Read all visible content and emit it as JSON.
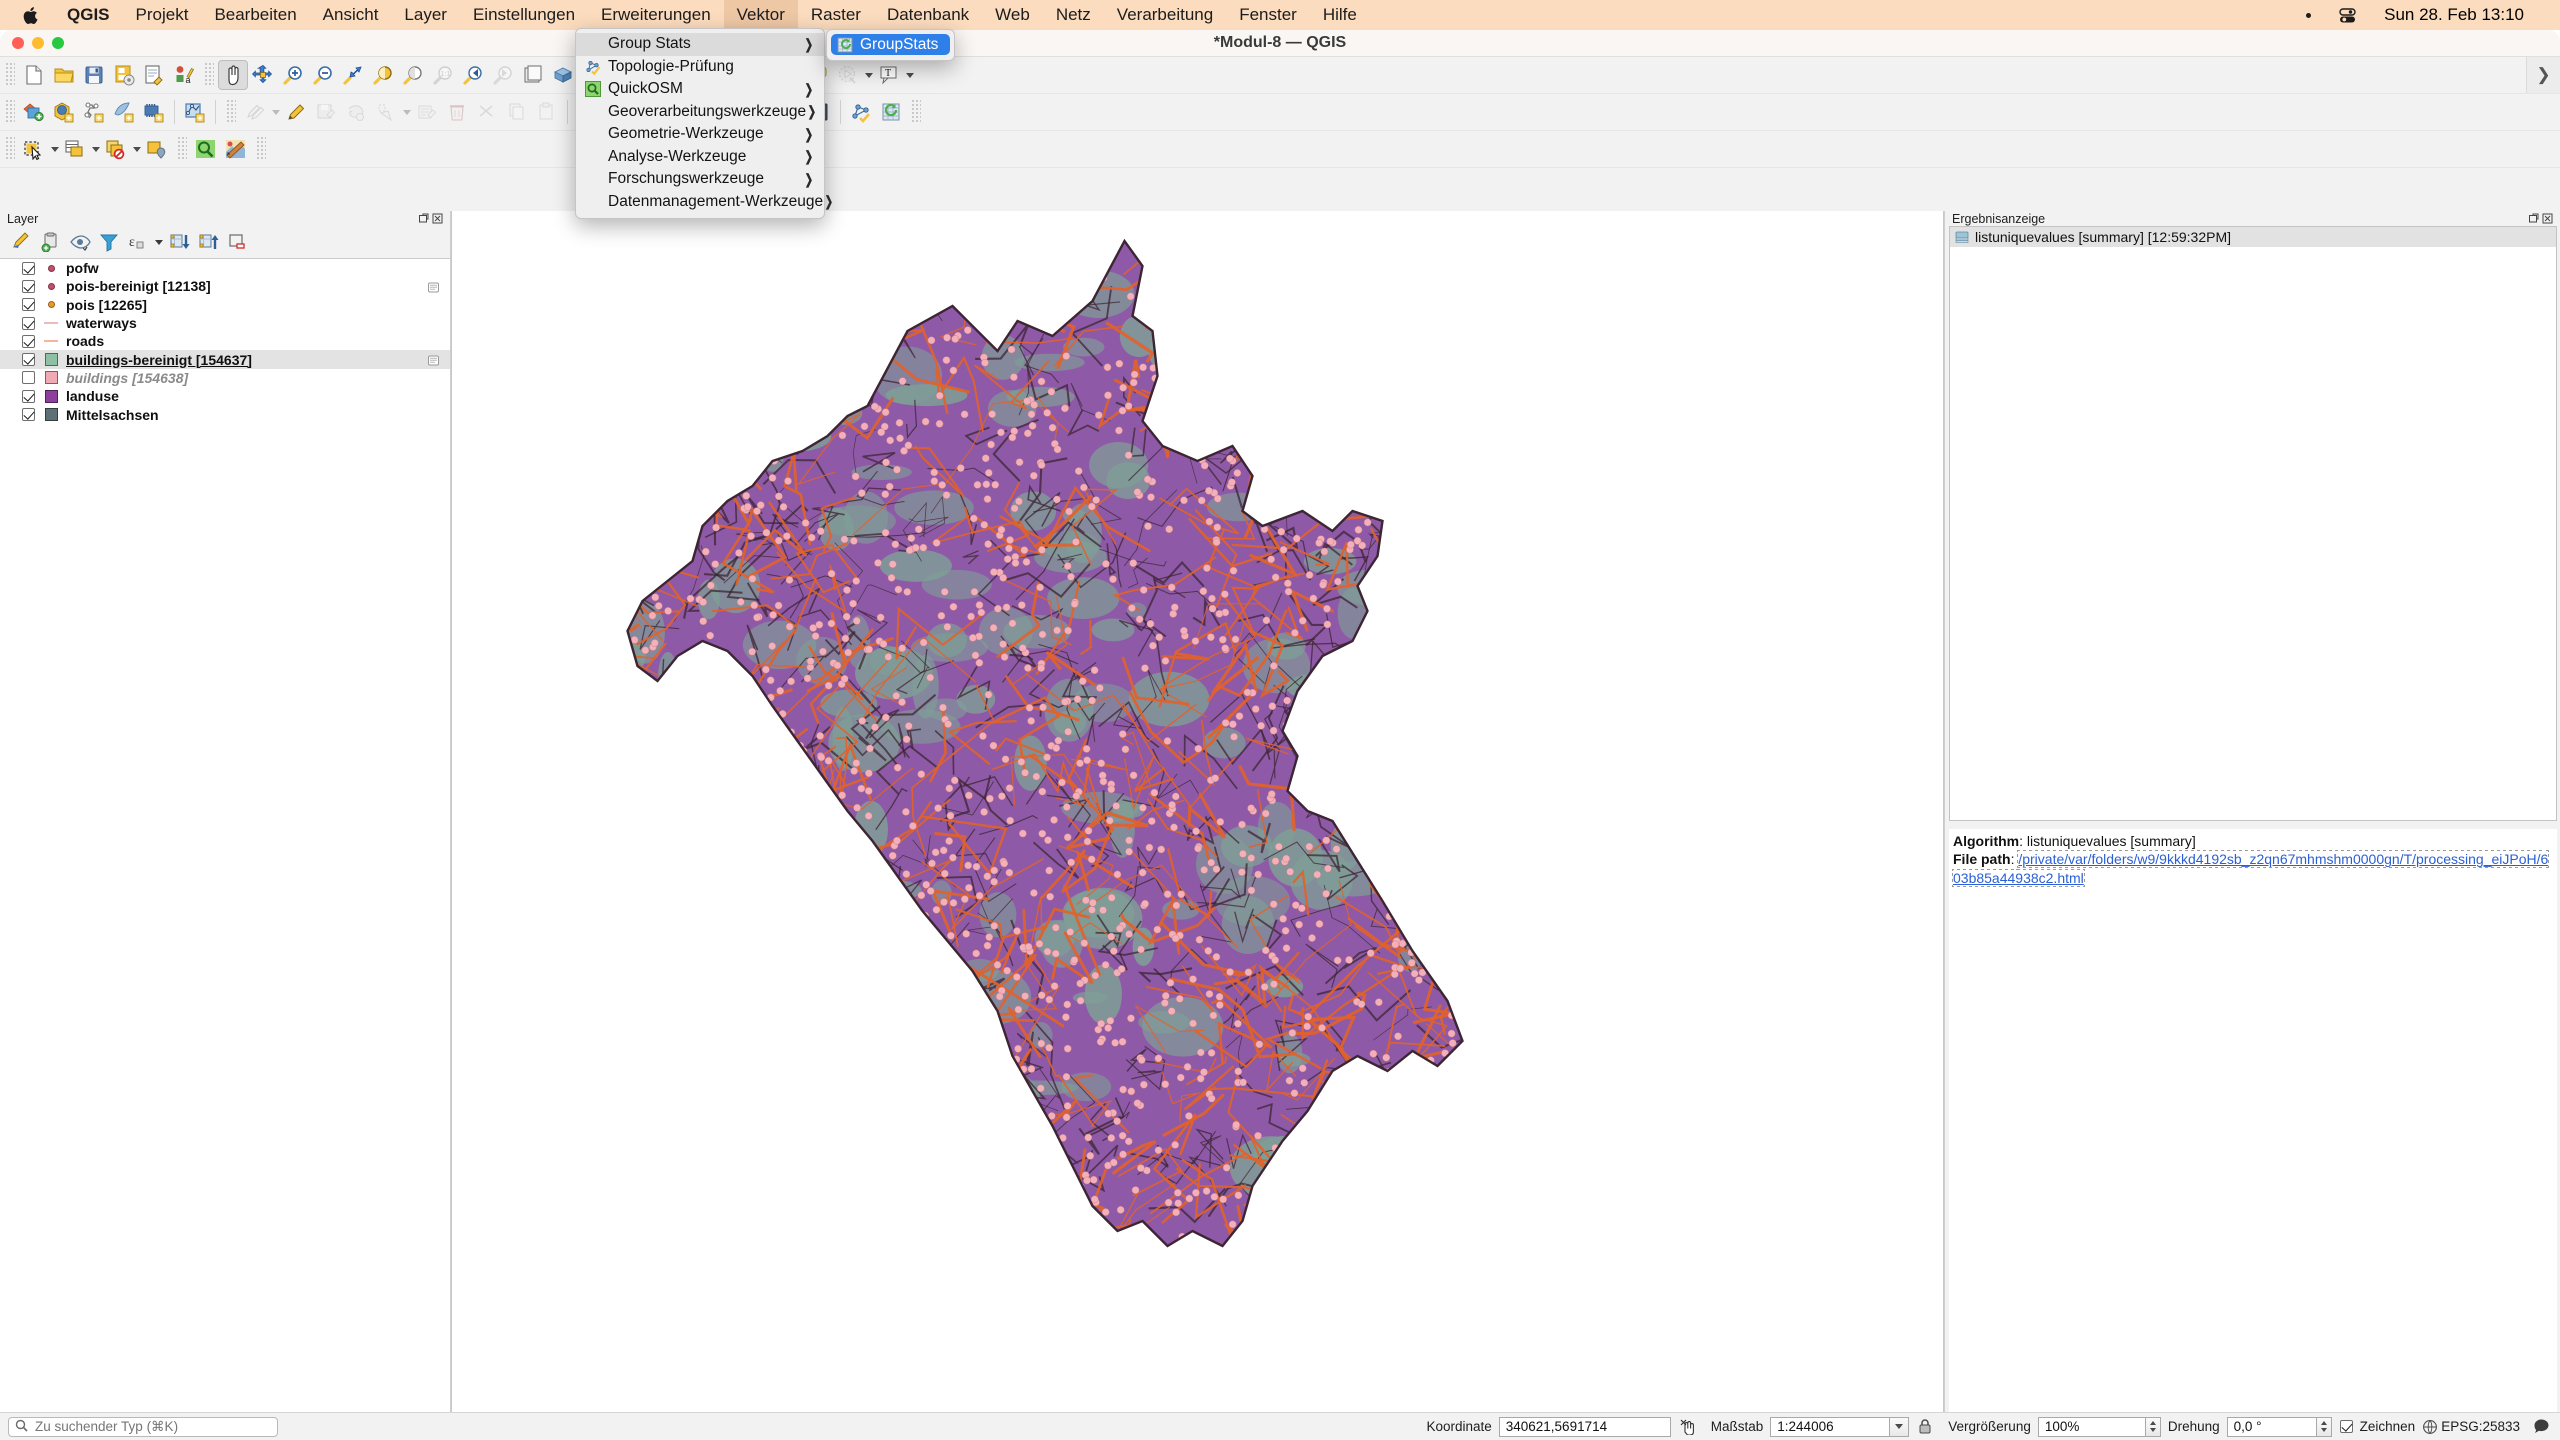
{
  "macbar": {
    "apple_icon": "apple-logo-icon",
    "items": [
      {
        "label": "QGIS",
        "bold": true,
        "active": false
      },
      {
        "label": "Projekt",
        "bold": false,
        "active": false
      },
      {
        "label": "Bearbeiten",
        "bold": false,
        "active": false
      },
      {
        "label": "Ansicht",
        "bold": false,
        "active": false
      },
      {
        "label": "Layer",
        "bold": false,
        "active": false
      },
      {
        "label": "Einstellungen",
        "bold": false,
        "active": false
      },
      {
        "label": "Erweiterungen",
        "bold": false,
        "active": false
      },
      {
        "label": "Vektor",
        "bold": false,
        "active": true
      },
      {
        "label": "Raster",
        "bold": false,
        "active": false
      },
      {
        "label": "Datenbank",
        "bold": false,
        "active": false
      },
      {
        "label": "Web",
        "bold": false,
        "active": false
      },
      {
        "label": "Netz",
        "bold": false,
        "active": false
      },
      {
        "label": "Verarbeitung",
        "bold": false,
        "active": false
      },
      {
        "label": "Fenster",
        "bold": false,
        "active": false
      },
      {
        "label": "Hilfe",
        "bold": false,
        "active": false
      }
    ],
    "right": {
      "bullet": "•",
      "control_center_icon": "control-center-icon",
      "clock": "Sun 28. Feb  13:10"
    },
    "background": "#fcdcbe"
  },
  "window": {
    "title": "*Modul-8 — QGIS",
    "traffic_lights": [
      "close-button",
      "minimize-button",
      "zoom-button"
    ]
  },
  "vektor_menu": {
    "items": [
      {
        "label": "Group Stats",
        "icon": null,
        "submenu": true,
        "highlighted": true
      },
      {
        "label": "Topologie-Prüfung",
        "icon": "topology-icon",
        "submenu": false,
        "highlighted": false
      },
      {
        "label": "QuickOSM",
        "icon": "quickosm-icon",
        "submenu": true,
        "highlighted": false
      },
      {
        "label": "Geoverarbeitungswerkzeuge",
        "icon": null,
        "submenu": true,
        "highlighted": false
      },
      {
        "label": "Geometrie-Werkzeuge",
        "icon": null,
        "submenu": true,
        "highlighted": false
      },
      {
        "label": "Analyse-Werkzeuge",
        "icon": null,
        "submenu": true,
        "highlighted": false
      },
      {
        "label": "Forschungswerkzeuge",
        "icon": null,
        "submenu": true,
        "highlighted": false
      },
      {
        "label": "Datenmanagement-Werkzeuge",
        "icon": null,
        "submenu": true,
        "highlighted": false
      }
    ],
    "submenu": {
      "items": [
        {
          "label": "GroupStats",
          "icon": "groupstats-icon",
          "selected": true
        }
      ],
      "highlight_color": "#2f7fe8"
    }
  },
  "toolbars": {
    "row1": [
      {
        "name": "new-project-button",
        "icon": "page-icon"
      },
      {
        "name": "open-project-button",
        "icon": "folder-icon"
      },
      {
        "name": "save-project-button",
        "icon": "floppy-icon"
      },
      {
        "name": "save-project-as-button",
        "icon": "floppy-gear-icon"
      },
      {
        "name": "new-print-layout-button",
        "icon": "layout-wrench-icon"
      },
      {
        "name": "style-manager-button",
        "icon": "style-icon"
      },
      {
        "name": "pan-map-button",
        "icon": "hand-icon",
        "selected": true
      },
      {
        "name": "pan-to-selection-button",
        "icon": "pan-selection-icon"
      },
      {
        "name": "zoom-in-button",
        "icon": "zoom-in-icon"
      },
      {
        "name": "zoom-out-button",
        "icon": "zoom-out-icon"
      },
      {
        "name": "zoom-full-button",
        "icon": "zoom-full-icon"
      },
      {
        "name": "zoom-to-selection-button",
        "icon": "zoom-selection-icon"
      },
      {
        "name": "zoom-to-layer-button",
        "icon": "zoom-layer-icon"
      },
      {
        "name": "zoom-native-button",
        "icon": "zoom-native-icon",
        "disabled": true
      },
      {
        "name": "zoom-last-button",
        "icon": "zoom-last-icon"
      },
      {
        "name": "zoom-next-button",
        "icon": "zoom-next-icon",
        "disabled": true
      },
      {
        "name": "new-map-view-button",
        "icon": "new-map-view-icon"
      },
      {
        "name": "new-3d-view-button",
        "icon": "new-3d-view-icon"
      },
      {
        "name": "refresh-button",
        "icon": "refresh-icon"
      },
      {
        "name": "identify-features-button",
        "icon": "identify-icon"
      },
      {
        "name": "attribute-table-button",
        "icon": "table-icon"
      },
      {
        "name": "field-calculator-button",
        "icon": "abacus-icon"
      },
      {
        "name": "processing-toolbox-button",
        "icon": "gear-icon"
      },
      {
        "name": "statistics-button",
        "icon": "sigma-icon"
      },
      {
        "name": "measure-line-button",
        "icon": "ruler-icon"
      },
      {
        "name": "map-tips-button",
        "icon": "maptip-icon"
      },
      {
        "name": "temporal-controller-button",
        "icon": "temporal-icon",
        "disabled": true
      },
      {
        "name": "text-annotation-button",
        "icon": "text-annotation-icon"
      }
    ],
    "row2": [
      {
        "name": "open-data-source-manager-button",
        "icon": "data-source-icon"
      },
      {
        "name": "add-vector-layer-button",
        "icon": "add-vector-icon"
      },
      {
        "name": "add-raster-layer-button",
        "icon": "add-raster-icon"
      },
      {
        "name": "add-mesh-layer-button",
        "icon": "add-mesh-icon"
      },
      {
        "name": "add-delimited-text-layer-button",
        "icon": "add-text-layer-icon"
      },
      {
        "name": "add-postgis-layer-button",
        "icon": "add-postgis-icon"
      },
      {
        "name": "current-edits-button",
        "icon": "pencil-multi-icon",
        "disabled": true
      },
      {
        "name": "toggle-editing-button",
        "icon": "pencil-icon"
      },
      {
        "name": "save-layer-edits-button",
        "icon": "save-edits-icon",
        "disabled": true
      },
      {
        "name": "add-feature-button",
        "icon": "add-polygon-icon",
        "disabled": true
      },
      {
        "name": "vertex-tool-button",
        "icon": "vertex-tool-icon",
        "disabled": true
      },
      {
        "name": "modify-attributes-button",
        "icon": "modify-attributes-icon",
        "disabled": true
      },
      {
        "name": "delete-selected-button",
        "icon": "trash-icon",
        "disabled": true
      },
      {
        "name": "cut-features-button",
        "icon": "scissors-icon",
        "disabled": true
      },
      {
        "name": "copy-features-button",
        "icon": "copy-icon",
        "disabled": true
      },
      {
        "name": "paste-features-button",
        "icon": "paste-icon",
        "disabled": true
      },
      {
        "name": "undo-button",
        "icon": "undo-icon",
        "disabled": true
      },
      {
        "name": "redo-button",
        "icon": "redo-icon",
        "disabled": true
      },
      {
        "name": "database-manager-button",
        "icon": "database-icon"
      },
      {
        "name": "metasearch-button",
        "icon": "globe-binoculars-icon"
      },
      {
        "name": "python-console-button",
        "icon": "python-icon"
      },
      {
        "name": "plugin-manager-button",
        "icon": "plugin-globe-icon"
      },
      {
        "name": "help-button",
        "icon": "help-book-icon"
      },
      {
        "name": "topology-checker-button",
        "icon": "topology-icon"
      },
      {
        "name": "groupstats-button",
        "icon": "groupstats-icon"
      }
    ],
    "row3": [
      {
        "name": "select-features-button",
        "icon": "select-rect-icon"
      },
      {
        "name": "select-by-value-button",
        "icon": "select-value-icon"
      },
      {
        "name": "deselect-features-button",
        "icon": "deselect-icon"
      },
      {
        "name": "select-by-location-button",
        "icon": "select-location-icon"
      },
      {
        "name": "quickosm-button",
        "icon": "quickosm-icon"
      },
      {
        "name": "osm-editor-button",
        "icon": "osm-editor-icon"
      }
    ]
  },
  "layer_panel": {
    "title": "Layer",
    "title_buttons": [
      "undock-icon",
      "close-icon"
    ],
    "tools": [
      {
        "name": "open-layer-styling-panel-button",
        "icon": "paintbrush-icon"
      },
      {
        "name": "add-group-button",
        "icon": "add-group-icon"
      },
      {
        "name": "manage-layer-visibility-button",
        "icon": "eye-icon",
        "has_caret": false
      },
      {
        "name": "filter-legend-button",
        "icon": "filter-icon"
      },
      {
        "name": "filter-legend-by-expression-button",
        "icon": "epsilon-icon",
        "has_caret": true
      },
      {
        "name": "expand-all-button",
        "icon": "expand-all-icon"
      },
      {
        "name": "collapse-all-button",
        "icon": "collapse-all-icon"
      },
      {
        "name": "remove-layer-button",
        "icon": "remove-layer-icon"
      }
    ],
    "layers": [
      {
        "name": "pofw",
        "checked": true,
        "symbol": "point",
        "color": "#c34f6e",
        "style": "normal",
        "selected": false,
        "indicator": false
      },
      {
        "name": "pois-bereinigt [12138]",
        "checked": true,
        "symbol": "point",
        "color": "#c34f6e",
        "style": "normal",
        "selected": false,
        "indicator": true
      },
      {
        "name": "pois [12265]",
        "checked": true,
        "symbol": "point",
        "color": "#e89a28",
        "style": "normal",
        "selected": false,
        "indicator": false
      },
      {
        "name": "waterways",
        "checked": true,
        "symbol": "line",
        "color": "#f0b9b9",
        "style": "normal",
        "selected": false,
        "indicator": false
      },
      {
        "name": "roads",
        "checked": true,
        "symbol": "line",
        "color": "#f2b79a",
        "style": "normal",
        "selected": false,
        "indicator": false
      },
      {
        "name": "buildings-bereinigt [154637]",
        "checked": true,
        "symbol": "polygon",
        "color": "#8fbfa4",
        "style": "underline",
        "selected": true,
        "indicator": true
      },
      {
        "name": "buildings [154638]",
        "checked": false,
        "symbol": "polygon",
        "color": "#f0a9b5",
        "style": "italic",
        "selected": false,
        "indicator": false
      },
      {
        "name": "landuse",
        "checked": true,
        "symbol": "polygon",
        "color": "#8e3f9e",
        "style": "normal",
        "selected": false,
        "indicator": false
      },
      {
        "name": "Mittelsachsen",
        "checked": true,
        "symbol": "polygon",
        "color": "#5f6f76",
        "style": "normal",
        "selected": false,
        "indicator": false
      }
    ]
  },
  "results_panel": {
    "title": "Ergebnisanzeige",
    "title_buttons": [
      "undock-icon",
      "close-icon"
    ],
    "entries": [
      {
        "icon": "result-html-icon",
        "label": "listuniquevalues [summary] [12:59:32PM]",
        "selected": true
      }
    ],
    "detail": {
      "algorithm_label": "Algorithm",
      "algorithm_value": "listuniquevalues [summary]",
      "filepath_label": "File path",
      "filepath_value": "/private/var/folders/w9/9kkkd4192sb_z2qn67mhmshm0000gn/T/processing_eiJPoH/603b85a44938c2.html"
    }
  },
  "status_bar": {
    "locator_placeholder": "Zu suchender Typ (⌘K)",
    "locator_value": "",
    "search_icon": "search-icon",
    "coordinate_label": "Koordinate",
    "coordinate_value": "340621,5691714",
    "toggle_extents_icon": "toggle-extents-icon",
    "scale_label": "Maßstab",
    "scale_value": "1:244006",
    "lock_icon": "lock-icon",
    "magnifier_label": "Vergrößerung",
    "magnifier_value": "100%",
    "rotation_label": "Drehung",
    "rotation_value": "0,0 °",
    "render_label": "Zeichnen",
    "render_checked": true,
    "crs_icon": "crs-globe-icon",
    "crs_label": "EPSG:25833",
    "messages_icon": "messages-icon"
  },
  "map": {
    "background": "#ffffff",
    "landuse_color": "#8e5aa8",
    "roads_color": "#e2622a",
    "buildings_color": "#7f9f96",
    "pois_color": "#f4b0b8",
    "outline_color": "#3d2533"
  }
}
